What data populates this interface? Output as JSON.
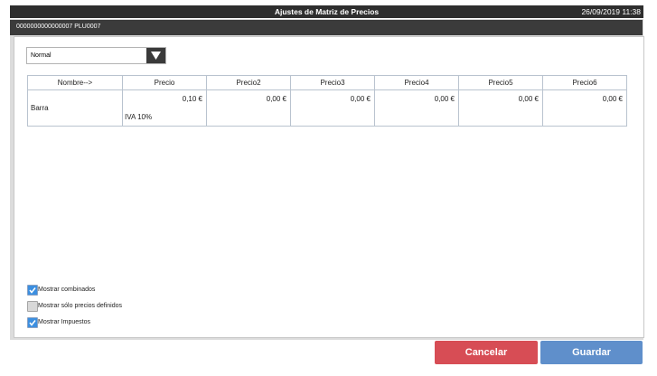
{
  "window": {
    "title": "Ajustes de Matriz de Precios",
    "datetime": "26/09/2019 11:38"
  },
  "subheader": {
    "text": "0000000000000007  PLU0007"
  },
  "dropdown": {
    "selected": "Normal"
  },
  "table": {
    "headers": [
      "Nombre-->",
      "Precio",
      "Precio2",
      "Precio3",
      "Precio4",
      "Precio5",
      "Precio6"
    ],
    "rows": [
      {
        "name": "Barra",
        "values": [
          "0,10 €",
          "0,00 €",
          "0,00 €",
          "0,00 €",
          "0,00 €",
          "0,00 €"
        ],
        "tax": "IVA 10%"
      }
    ]
  },
  "options": [
    {
      "label": "Mostrar combinados",
      "checked": true
    },
    {
      "label": "Mostrar sólo precios definidos",
      "checked": false
    },
    {
      "label": "Mostrar Impuestos",
      "checked": true
    }
  ],
  "buttons": {
    "cancel": "Cancelar",
    "save": "Guardar"
  },
  "colors": {
    "cancel": "#d74d55",
    "save": "#5f8fcb",
    "checkbox": "#3c8fe0",
    "titlebar": "#2e2e2e"
  }
}
